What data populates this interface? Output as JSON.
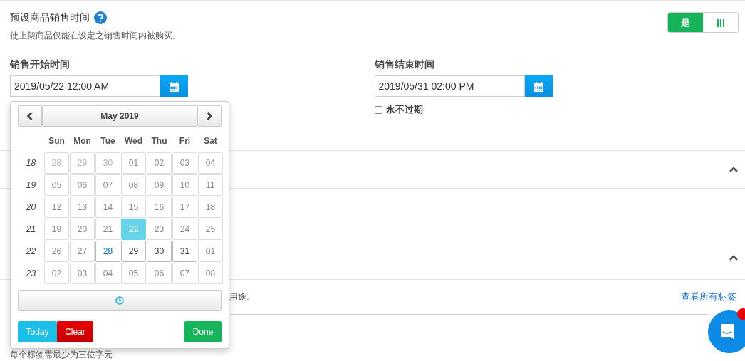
{
  "preset": {
    "title": "预设商品销售时间",
    "description": "使上架商品仅能在设定之销售时间内被购买。",
    "toggle": {
      "label": "是",
      "on": true
    }
  },
  "start": {
    "label": "销售开始时间",
    "value": "2019/05/22 12:00 AM"
  },
  "end": {
    "label": "销售结束时间",
    "value": "2019/05/31 02:00 PM",
    "never_expire": {
      "label": "永不过期",
      "checked": false
    }
  },
  "tags": {
    "hint_tail": "用途。",
    "link": "查看所有标签",
    "rule": "每个标签需最少为三位字元"
  },
  "calendar": {
    "month": "May 2019",
    "weekdays": [
      "Sun",
      "Mon",
      "Tue",
      "Wed",
      "Thu",
      "Fri",
      "Sat"
    ],
    "weeks": [
      {
        "week": "18",
        "days": [
          {
            "d": "28",
            "disabled": true,
            "faded": true,
            "selected": false,
            "today": false
          },
          {
            "d": "29",
            "disabled": true,
            "faded": true,
            "selected": false,
            "today": false
          },
          {
            "d": "30",
            "disabled": true,
            "faded": true,
            "selected": false,
            "today": false
          },
          {
            "d": "01",
            "disabled": true,
            "faded": false,
            "selected": false,
            "today": false
          },
          {
            "d": "02",
            "disabled": true,
            "faded": false,
            "selected": false,
            "today": false
          },
          {
            "d": "03",
            "disabled": true,
            "faded": false,
            "selected": false,
            "today": false
          },
          {
            "d": "04",
            "disabled": true,
            "faded": false,
            "selected": false,
            "today": false
          }
        ]
      },
      {
        "week": "19",
        "days": [
          {
            "d": "05",
            "disabled": true,
            "faded": false,
            "selected": false,
            "today": false
          },
          {
            "d": "06",
            "disabled": true,
            "faded": false,
            "selected": false,
            "today": false
          },
          {
            "d": "07",
            "disabled": true,
            "faded": false,
            "selected": false,
            "today": false
          },
          {
            "d": "08",
            "disabled": true,
            "faded": false,
            "selected": false,
            "today": false
          },
          {
            "d": "09",
            "disabled": true,
            "faded": false,
            "selected": false,
            "today": false
          },
          {
            "d": "10",
            "disabled": true,
            "faded": false,
            "selected": false,
            "today": false
          },
          {
            "d": "11",
            "disabled": true,
            "faded": false,
            "selected": false,
            "today": false
          }
        ]
      },
      {
        "week": "20",
        "days": [
          {
            "d": "12",
            "disabled": true,
            "faded": false,
            "selected": false,
            "today": false
          },
          {
            "d": "13",
            "disabled": true,
            "faded": false,
            "selected": false,
            "today": false
          },
          {
            "d": "14",
            "disabled": true,
            "faded": false,
            "selected": false,
            "today": false
          },
          {
            "d": "15",
            "disabled": true,
            "faded": false,
            "selected": false,
            "today": false
          },
          {
            "d": "16",
            "disabled": true,
            "faded": false,
            "selected": false,
            "today": false
          },
          {
            "d": "17",
            "disabled": true,
            "faded": false,
            "selected": false,
            "today": false
          },
          {
            "d": "18",
            "disabled": true,
            "faded": false,
            "selected": false,
            "today": false
          }
        ]
      },
      {
        "week": "21",
        "days": [
          {
            "d": "19",
            "disabled": true,
            "faded": false,
            "selected": false,
            "today": false
          },
          {
            "d": "20",
            "disabled": true,
            "faded": false,
            "selected": false,
            "today": false
          },
          {
            "d": "21",
            "disabled": true,
            "faded": false,
            "selected": false,
            "today": false
          },
          {
            "d": "22",
            "disabled": true,
            "faded": false,
            "selected": true,
            "today": false
          },
          {
            "d": "23",
            "disabled": true,
            "faded": false,
            "selected": false,
            "today": false
          },
          {
            "d": "24",
            "disabled": true,
            "faded": false,
            "selected": false,
            "today": false
          },
          {
            "d": "25",
            "disabled": true,
            "faded": false,
            "selected": false,
            "today": false
          }
        ]
      },
      {
        "week": "22",
        "days": [
          {
            "d": "26",
            "disabled": true,
            "faded": false,
            "selected": false,
            "today": false
          },
          {
            "d": "27",
            "disabled": true,
            "faded": false,
            "selected": false,
            "today": false
          },
          {
            "d": "28",
            "disabled": false,
            "faded": false,
            "selected": false,
            "today": true
          },
          {
            "d": "29",
            "disabled": false,
            "faded": false,
            "selected": false,
            "today": false
          },
          {
            "d": "30",
            "disabled": false,
            "faded": false,
            "selected": false,
            "today": false
          },
          {
            "d": "31",
            "disabled": false,
            "faded": false,
            "selected": false,
            "today": false
          },
          {
            "d": "01",
            "disabled": true,
            "faded": false,
            "selected": false,
            "today": false
          }
        ]
      },
      {
        "week": "23",
        "days": [
          {
            "d": "02",
            "disabled": true,
            "faded": false,
            "selected": false,
            "today": false
          },
          {
            "d": "03",
            "disabled": true,
            "faded": false,
            "selected": false,
            "today": false
          },
          {
            "d": "04",
            "disabled": true,
            "faded": false,
            "selected": false,
            "today": false
          },
          {
            "d": "05",
            "disabled": true,
            "faded": false,
            "selected": false,
            "today": false
          },
          {
            "d": "06",
            "disabled": true,
            "faded": false,
            "selected": false,
            "today": false
          },
          {
            "d": "07",
            "disabled": true,
            "faded": false,
            "selected": false,
            "today": false
          },
          {
            "d": "08",
            "disabled": true,
            "faded": false,
            "selected": false,
            "today": false
          }
        ]
      }
    ],
    "buttons": [
      {
        "label": "Today",
        "kind": "today"
      },
      {
        "label": "Clear",
        "kind": "clear"
      },
      {
        "label": "Done",
        "kind": "done"
      }
    ]
  }
}
